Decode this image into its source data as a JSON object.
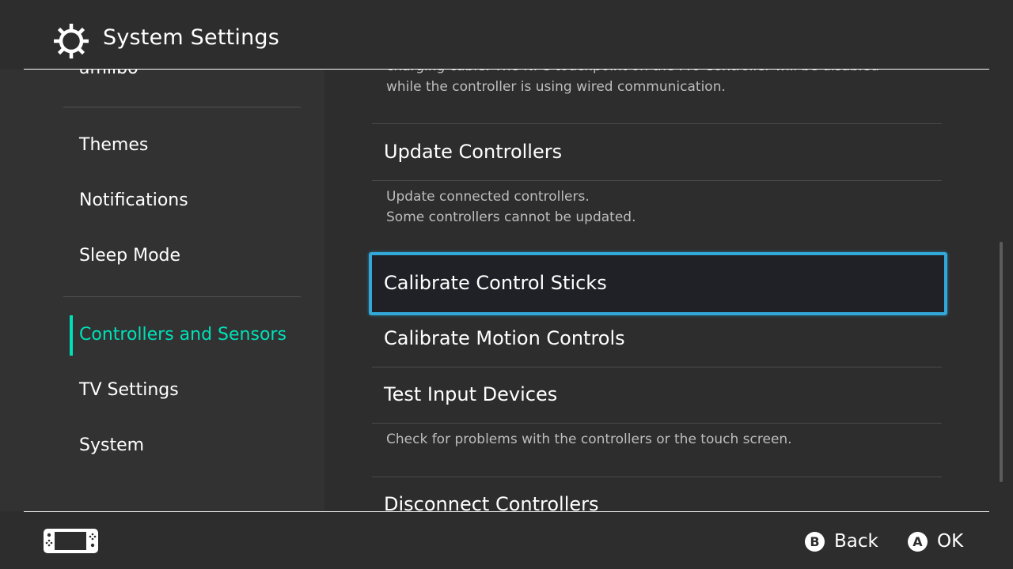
{
  "header": {
    "title": "System Settings",
    "icon": "gear-icon"
  },
  "sidebar": {
    "items": [
      {
        "label": "amiibo",
        "active": false
      },
      {
        "label": "Themes",
        "active": false
      },
      {
        "label": "Notifications",
        "active": false
      },
      {
        "label": "Sleep Mode",
        "active": false
      },
      {
        "label": "Controllers and Sensors",
        "active": true
      },
      {
        "label": "TV Settings",
        "active": false
      },
      {
        "label": "System",
        "active": false
      }
    ]
  },
  "main": {
    "top_desc_line1": "charging cable. The NFC touchpoint on the Pro Controller will be disabled",
    "top_desc_line2": "while the controller is using wired communication.",
    "rows": [
      {
        "title": "Update Controllers",
        "desc": [
          "Update connected controllers.",
          "Some controllers cannot be updated."
        ]
      },
      {
        "title": "Calibrate Control Sticks",
        "selected": true
      },
      {
        "title": "Calibrate Motion Controls"
      },
      {
        "title": "Test Input Devices",
        "desc": [
          "Check for problems with the controllers or the touch screen."
        ]
      },
      {
        "title": "Disconnect Controllers"
      }
    ]
  },
  "footer": {
    "device_icon": "handheld-console-icon",
    "back": {
      "button": "B",
      "label": "Back"
    },
    "ok": {
      "button": "A",
      "label": "OK"
    }
  },
  "colors": {
    "accent": "#00e0b8",
    "selection": "#31a8d8",
    "background": "#2d2d2d"
  }
}
